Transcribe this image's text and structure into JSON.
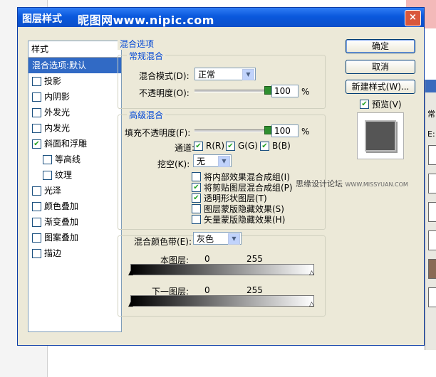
{
  "dialog": {
    "title": "图层样式",
    "watermark": "昵图网www.nipic.com",
    "close_glyph": "×"
  },
  "style_list": {
    "header": "样式",
    "items": [
      {
        "label": "混合选项:默认",
        "selected": true,
        "checkbox": false
      },
      {
        "label": "投影",
        "checked": false,
        "checkbox": true
      },
      {
        "label": "内阴影",
        "checked": false,
        "checkbox": true
      },
      {
        "label": "外发光",
        "checked": false,
        "checkbox": true
      },
      {
        "label": "内发光",
        "checked": false,
        "checkbox": true
      },
      {
        "label": "斜面和浮雕",
        "checked": true,
        "checkbox": true
      },
      {
        "label": "等高线",
        "checked": false,
        "checkbox": true,
        "sub": true
      },
      {
        "label": "纹理",
        "checked": false,
        "checkbox": true,
        "sub": true
      },
      {
        "label": "光泽",
        "checked": false,
        "checkbox": true
      },
      {
        "label": "颜色叠加",
        "checked": false,
        "checkbox": true
      },
      {
        "label": "渐变叠加",
        "checked": false,
        "checkbox": true
      },
      {
        "label": "图案叠加",
        "checked": false,
        "checkbox": true
      },
      {
        "label": "描边",
        "checked": false,
        "checkbox": true
      }
    ]
  },
  "blend_options": {
    "title": "混合选项",
    "general": {
      "title": "常规混合",
      "mode_label": "混合模式(D):",
      "mode_value": "正常",
      "opacity_label": "不透明度(O):",
      "opacity_value": "100",
      "opacity_unit": "%",
      "opacity_level": 1.0
    },
    "advanced": {
      "title": "高级混合",
      "fill_label": "填充不透明度(F):",
      "fill_value": "100",
      "fill_unit": "%",
      "fill_level": 1.0,
      "channels_label": "通道:",
      "channel_r": "R(R)",
      "channel_g": "G(G)",
      "channel_b": "B(B)",
      "knockout_label": "挖空(K):",
      "knockout_value": "无",
      "options": [
        {
          "label": "将内部效果混合成组(I)",
          "checked": false
        },
        {
          "label": "将剪贴图层混合成组(P)",
          "checked": true
        },
        {
          "label": "透明形状图层(T)",
          "checked": true
        },
        {
          "label": "图层蒙版隐藏效果(S)",
          "checked": false
        },
        {
          "label": "矢量蒙版隐藏效果(H)",
          "checked": false
        }
      ]
    },
    "blend_if": {
      "label": "混合颜色带(E):",
      "value": "灰色",
      "this_layer_label": "本图层:",
      "this_layer_min": "0",
      "this_layer_max": "255",
      "underlying_label": "下一图层:",
      "underlying_min": "0",
      "underlying_max": "255"
    }
  },
  "buttons": {
    "ok": "确定",
    "cancel": "取消",
    "new_style": "新建样式(W)...",
    "preview_label": "预览(V)",
    "preview_checked": true
  },
  "site_watermark": {
    "text": "思缘设计论坛",
    "url": "WWW.MISSYUAN.COM"
  },
  "side_panel": {
    "fragment1": "常",
    "fragment2": "E:"
  },
  "icons": {
    "check": "✔",
    "dropdown": "▼",
    "marker_black": "▲",
    "marker_white": "△"
  }
}
